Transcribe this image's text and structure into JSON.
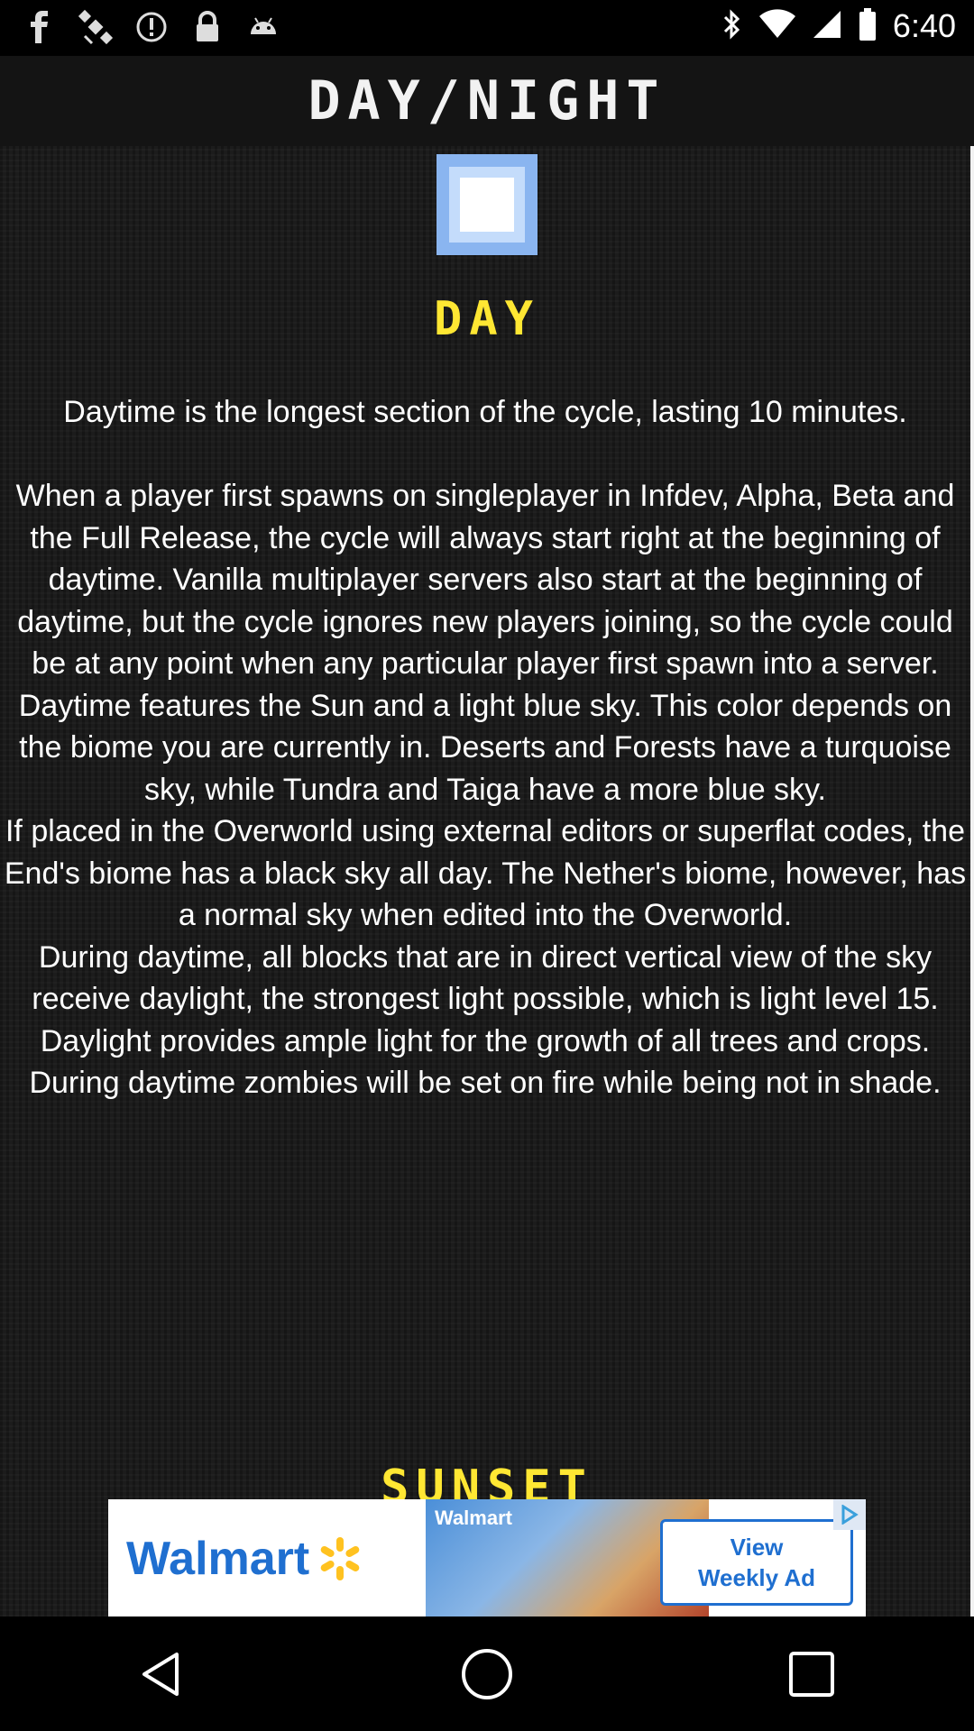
{
  "status_bar": {
    "time": "6:40",
    "left_icons": [
      "facebook-icon",
      "gps-icon",
      "alert-icon",
      "lock-icon",
      "android-icon"
    ],
    "right_icons": [
      "bluetooth-icon",
      "wifi-icon",
      "signal-icon",
      "battery-icon"
    ]
  },
  "header": {
    "title": "DAY/NIGHT"
  },
  "content": {
    "day_heading": "DAY",
    "day_text": "Daytime is the longest section of the cycle, lasting 10 minutes.\n\nWhen a player first spawns on singleplayer in Infdev, Alpha, Beta and the Full Release, the cycle will always start right at the beginning of daytime. Vanilla multiplayer servers also start at the beginning of daytime, but the cycle ignores new players joining, so the cycle could be at any point when any particular player first spawn into a server.\nDaytime features the Sun and a light blue sky. This color depends on the biome you are currently in. Deserts and Forests have a turquoise sky, while Tundra and Taiga have a more blue sky.\nIf placed in the Overworld using external editors or superflat codes, the End's biome has a black sky all day. The Nether's biome, however, has a normal sky when edited into the Overworld.\nDuring daytime, all blocks that are in direct vertical view of the sky receive daylight, the strongest light possible, which is light level 15.\nDaylight provides ample light for the growth of all trees and crops.\nDuring daytime zombies will be set on fire while being not in shade.",
    "sunset_heading": "SUNSET"
  },
  "ad": {
    "brand": "Walmart",
    "photo_label": "Walmart",
    "cta": "View\nWeekly Ad"
  },
  "nav": [
    "back-icon",
    "home-icon",
    "recents-icon"
  ],
  "colors": {
    "heading": "#ffe733",
    "sun_outer": "#8ab5f0",
    "brand_blue": "#1f6fd0",
    "spark": "#ffc220"
  }
}
